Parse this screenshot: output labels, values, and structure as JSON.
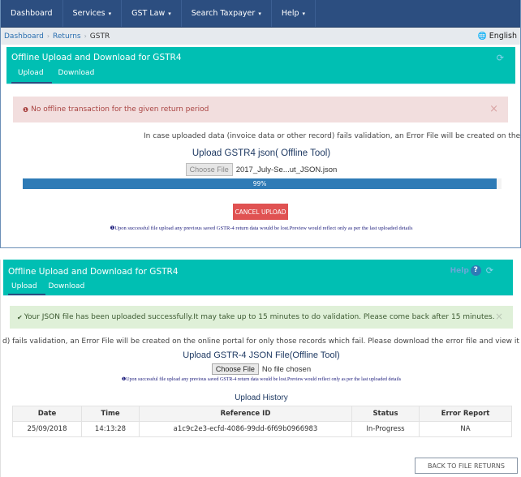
{
  "navbar": {
    "items": [
      {
        "label": "Dashboard",
        "has_caret": false
      },
      {
        "label": "Services",
        "has_caret": true
      },
      {
        "label": "GST Law",
        "has_caret": true
      },
      {
        "label": "Search Taxpayer",
        "has_caret": true
      },
      {
        "label": "Help",
        "has_caret": true
      }
    ],
    "caret": "▾"
  },
  "breadcrumb": {
    "items": [
      "Dashboard",
      "Returns",
      "GSTR"
    ],
    "separator": "›"
  },
  "language": {
    "icon": "globe-icon",
    "label": "English"
  },
  "panel1": {
    "title": "Offline Upload and Download for GSTR4",
    "tabs": [
      "Upload",
      "Download"
    ],
    "active_tab": "Upload",
    "refresh_icon": "⟳",
    "error_alert": {
      "icon": "❶",
      "text": "No offline transaction for the given return period",
      "close": "×"
    },
    "info_text": "In case uploaded data (invoice data or other record) fails validation, an Error File will be created on the online port",
    "upload_title": "Upload GSTR4 json( Offline Tool)",
    "choose_file_label": "Choose File",
    "file_name": "2017_July-Se...ut_JSON.json",
    "progress_percent": 99,
    "progress_label": "99%",
    "cancel_label": "CANCEL UPLOAD",
    "note": "❶Upon successful file upload any previous saved GSTR-4 return data would be lost.Preview would reflect only as per the last uploaded details"
  },
  "panel2": {
    "title": "Offline Upload and Download for GSTR4",
    "tabs": [
      "Upload",
      "Download"
    ],
    "active_tab": "Upload",
    "help_label": "Help",
    "help_icon": "?",
    "refresh_icon": "⟳",
    "success_alert": {
      "icon": "✔",
      "text": "Your JSON file has been uploaded successfully.It may take up to 15 minutes to do validation. Please come back after 15 minutes.",
      "close": "×"
    },
    "info_text": "d) fails validation, an Error File will be created on the online portal for only those records which fail. Please download the error file and view it in the Offline",
    "upload_title": "Upload GSTR-4 JSON File(Offline Tool)",
    "choose_file_label": "Choose File",
    "file_name": "No file chosen",
    "note": "❶Upon successful file upload any previous saved GSTR-4 return data would be lost.Preview would reflect only as per the last uploaded details",
    "history_title": "Upload History",
    "history_columns": [
      "Date",
      "Time",
      "Reference ID",
      "Status",
      "Error Report"
    ],
    "history_rows": [
      [
        "25/09/2018",
        "14:13:28",
        "a1c9c2e3-ecfd-4086-99dd-6f69b0966983",
        "In-Progress",
        "NA"
      ]
    ],
    "back_label": "BACK TO FILE RETURNS"
  },
  "colors": {
    "navbar": "#2c4e80",
    "teal_header": "#00bfb3",
    "error_bg": "#f2dede",
    "success_bg": "#dff0d8",
    "progress": "#2e7bb6",
    "cancel": "#e05252"
  }
}
